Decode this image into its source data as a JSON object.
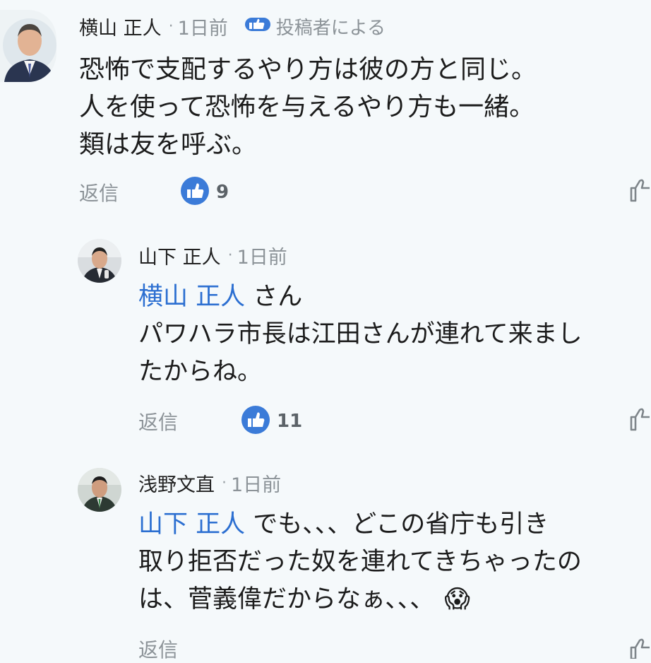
{
  "comments": [
    {
      "author": "横山 正人",
      "dot": "·",
      "time": "1日前",
      "owner_tag": "投稿者による",
      "lines": [
        "恐怖で支配するやり方は彼の方と同じ。",
        "人を使って恐怖を与えるやり方も一緒。",
        "類は友を呼ぶ。"
      ],
      "reply_label": "返信",
      "like_count": "9"
    },
    {
      "author": "山下 正人",
      "dot": "·",
      "time": "1日前",
      "mention": "横山 正人",
      "lines": [
        " さん",
        "パワハラ市長は江田さんが連れて来まし",
        "たからね。"
      ],
      "reply_label": "返信",
      "like_count": "11"
    },
    {
      "author": "浅野文直",
      "dot": "·",
      "time": "1日前",
      "mention": "山下 正人",
      "lines": [
        " でも、、、どこの省庁も引き",
        "取り拒否だった奴を連れてきちゃったの",
        "は、菅義偉だからなぁ、、、"
      ],
      "emoji": "😱",
      "reply_label": "返信"
    }
  ],
  "colors": {
    "mention": "#2c6fd1",
    "like_blue": "#3b7bd8",
    "meta_gray": "#8c9398",
    "background": "#f5f9fb"
  },
  "icons": [
    "thumbs-up-icon",
    "thumbs-up-outline-icon",
    "avatar"
  ]
}
